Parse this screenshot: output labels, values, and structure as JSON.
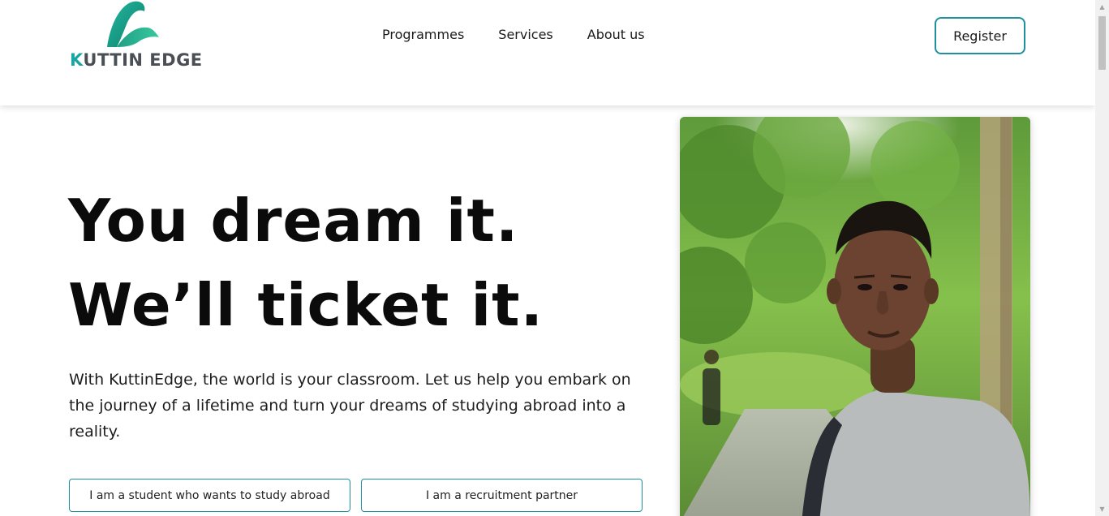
{
  "brand": {
    "name_initial": "K",
    "name_rest": "UTTIN EDGE",
    "accent_color": "#1aa6a0",
    "logo_icon": "kuttin-edge-wave-logo"
  },
  "nav": {
    "items": [
      {
        "label": "Programmes"
      },
      {
        "label": "Services"
      },
      {
        "label": "About us"
      }
    ]
  },
  "header": {
    "register_label": "Register"
  },
  "hero": {
    "title_line1": "You dream it.",
    "title_line2": "We’ll ticket it.",
    "description": "With KuttinEdge, the world is your classroom. Let us help you embark on the journey of a lifetime and turn your dreams of studying abroad into a reality.",
    "cta_student": "I am a student who wants to study abroad",
    "cta_partner": "I am a recruitment partner",
    "button_border_color": "#1e8f9c"
  },
  "image": {
    "subject": "student-photo"
  }
}
